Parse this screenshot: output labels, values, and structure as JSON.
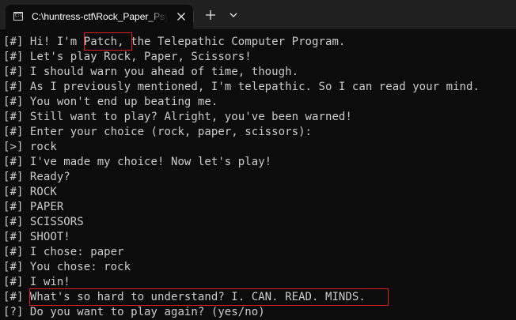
{
  "window": {
    "tab_title": "C:\\huntress-ctf\\Rock_Paper_Psychic.exe",
    "tab_icon": "terminal-icon",
    "close_icon": "close-icon",
    "new_tab_icon": "plus-icon",
    "dropdown_icon": "chevron-down-icon",
    "colors": {
      "background": "#0c0c0c",
      "tabstrip": "#202020",
      "text": "#cccccc",
      "highlight_box": "#e01b24"
    }
  },
  "terminal": {
    "lines": [
      "[#] Hi! I'm Patch, the Telepathic Computer Program.",
      "[#] Let's play Rock, Paper, Scissors!",
      "[#] I should warn you ahead of time, though.",
      "[#] As I previously mentioned, I'm telepathic. So I can read your mind.",
      "[#] You won't end up beating me.",
      "[#] Still want to play? Alright, you've been warned!",
      "[#] Enter your choice (rock, paper, scissors):",
      "[>] rock",
      "[#] I've made my choice! Now let's play!",
      "[#] Ready?",
      "[#] ROCK",
      "[#] PAPER",
      "[#] SCISSORS",
      "[#] SHOOT!",
      "[#] I chose: paper",
      "[#] You chose: rock",
      "[#] I win!",
      "[#] What's so hard to understand? I. CAN. READ. MINDS.",
      "[?] Do you want to play again? (yes/no)"
    ]
  }
}
